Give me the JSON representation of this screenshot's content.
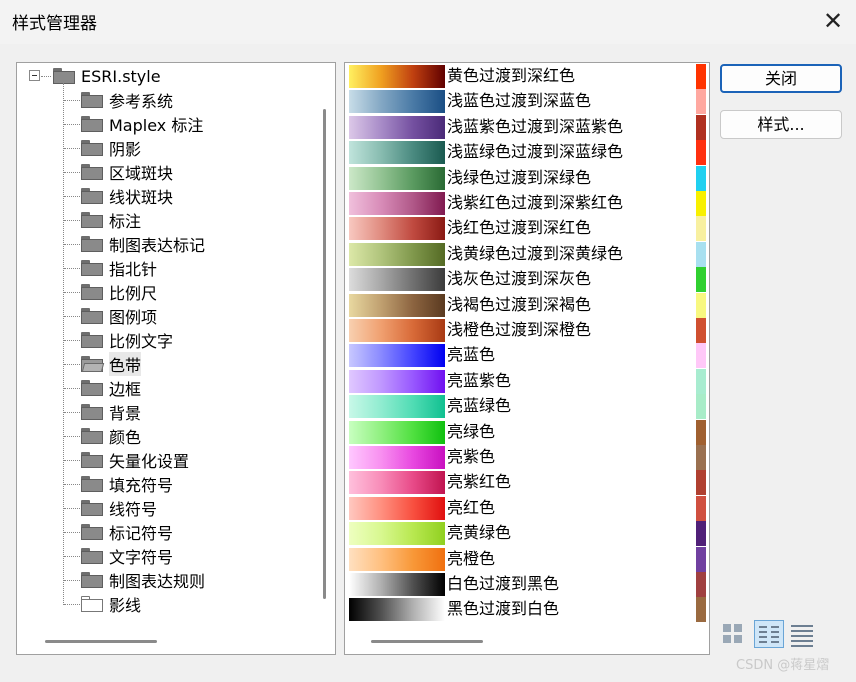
{
  "window": {
    "title": "样式管理器",
    "close_glyph": "✕"
  },
  "tree": {
    "root": "ESRI.style",
    "items": [
      {
        "label": "参考系统",
        "icon": "folder-icon"
      },
      {
        "label": "Maplex 标注",
        "icon": "folder-icon"
      },
      {
        "label": "阴影",
        "icon": "folder-icon"
      },
      {
        "label": "区域斑块",
        "icon": "folder-icon"
      },
      {
        "label": "线状斑块",
        "icon": "folder-icon"
      },
      {
        "label": "标注",
        "icon": "folder-icon"
      },
      {
        "label": "制图表达标记",
        "icon": "folder-icon"
      },
      {
        "label": "指北针",
        "icon": "folder-icon"
      },
      {
        "label": "比例尺",
        "icon": "folder-icon"
      },
      {
        "label": "图例项",
        "icon": "folder-icon"
      },
      {
        "label": "比例文字",
        "icon": "folder-icon"
      },
      {
        "label": "色带",
        "icon": "folder-open-icon",
        "selected": true
      },
      {
        "label": "边框",
        "icon": "folder-icon"
      },
      {
        "label": "背景",
        "icon": "folder-icon"
      },
      {
        "label": "颜色",
        "icon": "folder-icon"
      },
      {
        "label": "矢量化设置",
        "icon": "folder-icon"
      },
      {
        "label": "填充符号",
        "icon": "folder-icon"
      },
      {
        "label": "线符号",
        "icon": "folder-icon"
      },
      {
        "label": "标记符号",
        "icon": "folder-icon"
      },
      {
        "label": "文字符号",
        "icon": "folder-icon"
      },
      {
        "label": "制图表达规则",
        "icon": "folder-icon"
      },
      {
        "label": "影线",
        "icon": "folder-empty-icon"
      }
    ]
  },
  "color_ramps": [
    {
      "label": "黄色过渡到深红色",
      "colors": [
        "#fff060",
        "#f0a020",
        "#c04010",
        "#600000"
      ]
    },
    {
      "label": "浅蓝色过渡到深蓝色",
      "colors": [
        "#c8dde8",
        "#84a8c4",
        "#4a7aa6",
        "#1a4e84"
      ]
    },
    {
      "label": "浅蓝紫色过渡到深蓝紫色",
      "colors": [
        "#dcc8e8",
        "#a88cc8",
        "#7450a0",
        "#4a2a78"
      ]
    },
    {
      "label": "浅蓝绿色过渡到深蓝绿色",
      "colors": [
        "#c0e4dc",
        "#88bcb0",
        "#4a8a80",
        "#1a5a50"
      ]
    },
    {
      "label": "浅绿色过渡到深绿色",
      "colors": [
        "#cce8c8",
        "#94c494",
        "#5a9a60",
        "#2a6a34"
      ]
    },
    {
      "label": "浅紫红色过渡到深紫红色",
      "colors": [
        "#f0c0dc",
        "#d88cb8",
        "#b05888",
        "#801a50"
      ]
    },
    {
      "label": "浅红色过渡到深红色",
      "colors": [
        "#f8c8c0",
        "#e08c80",
        "#c04a40",
        "#8a1a14"
      ]
    },
    {
      "label": "浅黄绿色过渡到深黄绿色",
      "colors": [
        "#dce8a8",
        "#b0c47c",
        "#80984c",
        "#546a24"
      ]
    },
    {
      "label": "浅灰色过渡到深灰色",
      "colors": [
        "#dcdcdc",
        "#a8a8a8",
        "#707070",
        "#3c3c3c"
      ]
    },
    {
      "label": "浅褐色过渡到深褐色",
      "colors": [
        "#e8d8a0",
        "#c0a070",
        "#8c6440",
        "#5a3a20"
      ]
    },
    {
      "label": "浅橙色过渡到深橙色",
      "colors": [
        "#f8d0b0",
        "#f0a070",
        "#d86a38",
        "#a83a14"
      ]
    },
    {
      "label": "亮蓝色",
      "colors": [
        "#c8c8ff",
        "#8a8aff",
        "#4444ff",
        "#0000f0"
      ]
    },
    {
      "label": "亮蓝紫色",
      "colors": [
        "#e0c8ff",
        "#c098ff",
        "#9858ff",
        "#7010f0"
      ]
    },
    {
      "label": "亮蓝绿色",
      "colors": [
        "#c8f8e8",
        "#90ecd0",
        "#50dcb4",
        "#10c090"
      ]
    },
    {
      "label": "亮绿色",
      "colors": [
        "#c8ffc0",
        "#90f080",
        "#50e040",
        "#10c010"
      ]
    },
    {
      "label": "亮紫色",
      "colors": [
        "#ffc8ff",
        "#f890f0",
        "#e848e0",
        "#c810c0"
      ]
    },
    {
      "label": "亮紫红色",
      "colors": [
        "#ffc0dc",
        "#f88cb8",
        "#e84a88",
        "#c01450"
      ]
    },
    {
      "label": "亮红色",
      "colors": [
        "#ffc8c0",
        "#ff9080",
        "#f85040",
        "#e01010"
      ]
    },
    {
      "label": "亮黄绿色",
      "colors": [
        "#eeffc0",
        "#d8f890",
        "#b8e850",
        "#90d020"
      ]
    },
    {
      "label": "亮橙色",
      "colors": [
        "#ffe0c0",
        "#ffc080",
        "#f89838",
        "#f07010"
      ]
    },
    {
      "label": "白色过渡到黑色",
      "colors": [
        "#ffffff",
        "#b0b0b0",
        "#505050",
        "#000000"
      ]
    },
    {
      "label": "黑色过渡到白色",
      "colors": [
        "#000000",
        "#505050",
        "#b0b0b0",
        "#ffffff"
      ]
    }
  ],
  "side_colors": [
    "#ff3300",
    "#ffa8a0",
    "#b03020",
    "#ff3010",
    "#20d0f0",
    "#f8f000",
    "#f8f0a0",
    "#a8e0f0",
    "#30d030",
    "#f8f880",
    "#d05030",
    "#ffc8f8",
    "#a8ecd0",
    "#a8ecc8",
    "#a06030",
    "#9a7050",
    "#b04030",
    "#d05040",
    "#502078",
    "#7040a0",
    "#a04040",
    "#9a6a40"
  ],
  "buttons": {
    "close": "关闭",
    "styles": "样式..."
  },
  "view_modes": [
    "large-icons-view-icon",
    "list-view-icon",
    "details-view-icon"
  ],
  "watermark": "CSDN @蒋星熠"
}
